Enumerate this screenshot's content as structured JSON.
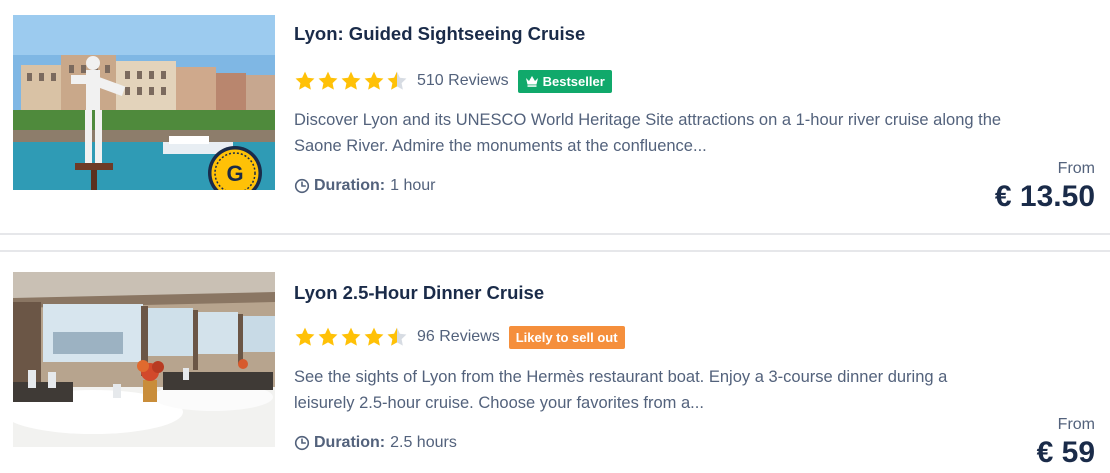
{
  "colors": {
    "text_primary": "#1a2b49",
    "text_secondary": "#53627c",
    "star": "#ffc107",
    "bestseller_badge": "#10a96b",
    "likely_to_sell_out_badge": "#f58f3c",
    "divider": "#e6e7ea"
  },
  "activities": [
    {
      "title": "Lyon: Guided Sightseeing Cruise",
      "rating": 4.5,
      "reviews_text": "510 Reviews",
      "badge": "Bestseller",
      "description_line1": "Discover Lyon and its UNESCO World Heritage Site attractions on a 1-hour river cruise along the",
      "description_line2": "Saone River. Admire the monuments at the confluence...",
      "duration_label": "Duration:",
      "duration_value": "1 hour",
      "price_prefix": "From",
      "price": "€ 13.50",
      "image_icon": "statue-riverside-photo",
      "overlay_badge_letter": "G"
    },
    {
      "title": "Lyon 2.5-Hour Dinner Cruise",
      "rating": 4.5,
      "reviews_text": "96 Reviews",
      "badge": "Likely to sell out",
      "description_line1": "See the sights of Lyon from the Hermès restaurant boat. Enjoy a 3-course dinner during a",
      "description_line2": "leisurely 2.5-hour cruise. Choose your favorites from a...",
      "duration_label": "Duration:",
      "duration_value": "2.5 hours",
      "price_prefix": "From",
      "price": "€ 59",
      "image_icon": "dining-room-photo"
    }
  ]
}
